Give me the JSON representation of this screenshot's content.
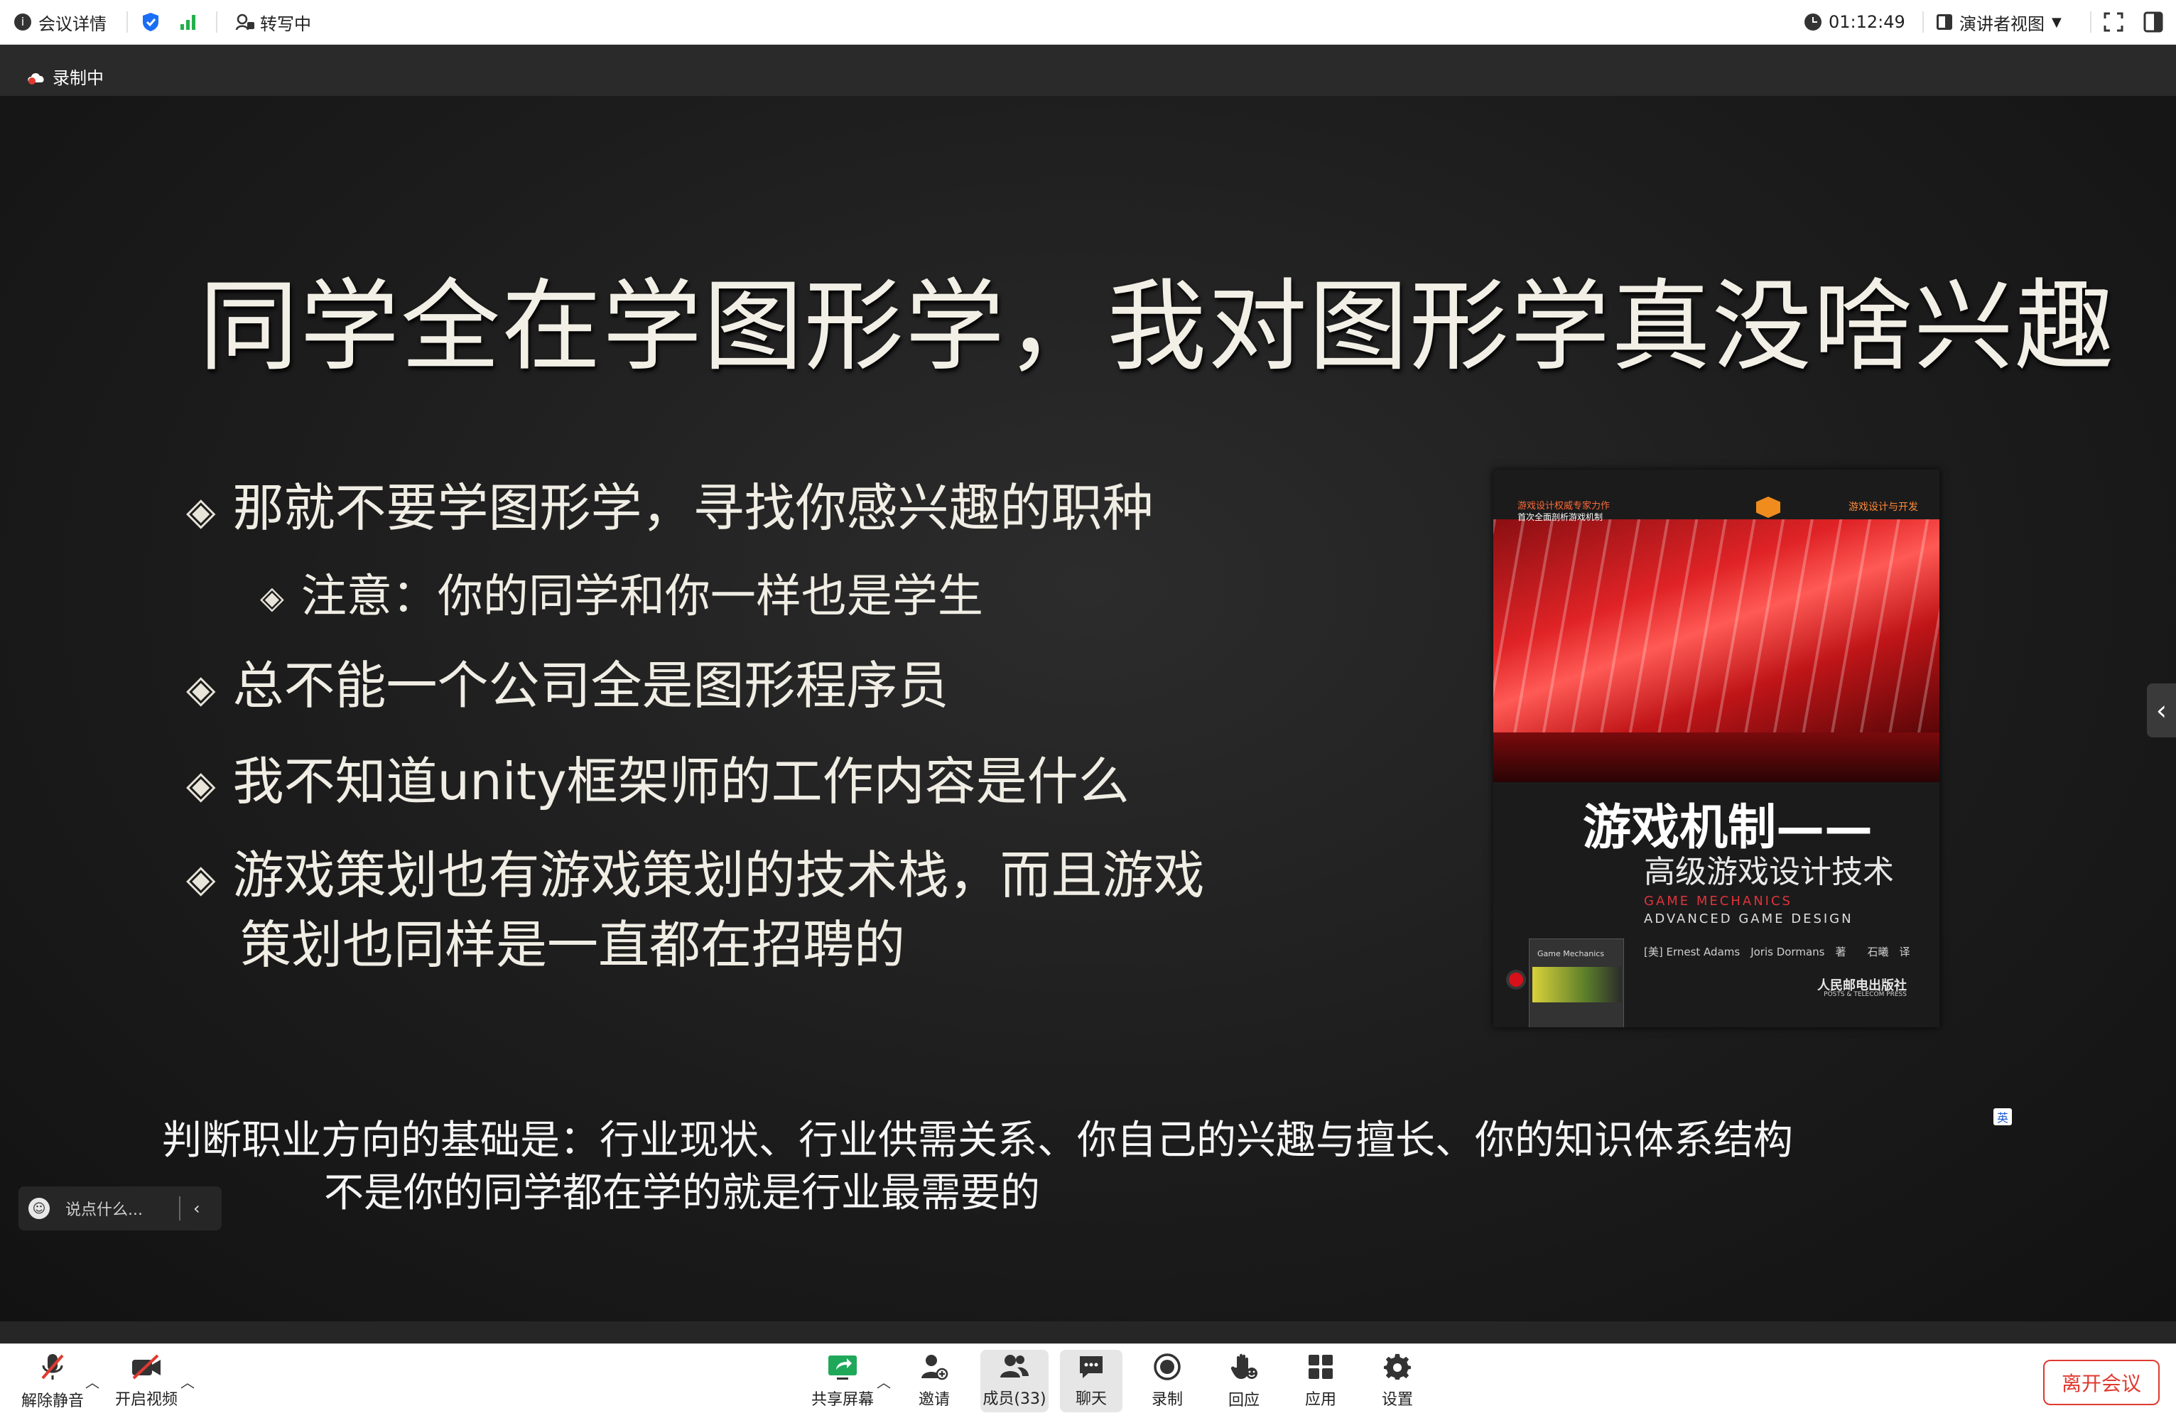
{
  "topbar": {
    "meeting_info": "会议详情",
    "transcribe": "转写中",
    "time": "01:12:49",
    "view_mode": "演讲者视图"
  },
  "recording": {
    "label": "录制中"
  },
  "slide": {
    "title": "同学全在学图形学，我对图形学真没啥兴趣",
    "bullets": [
      {
        "level": 1,
        "text": "那就不要学图形学，寻找你感兴趣的职种"
      },
      {
        "level": 2,
        "text": "注意：你的同学和你一样也是学生"
      },
      {
        "level": 1,
        "text": "总不能一个公司全是图形程序员"
      },
      {
        "level": 1,
        "text": "我不知道unity框架师的工作内容是什么"
      },
      {
        "level": 1,
        "text": "游戏策划也有游戏策划的技术栈，而且游戏"
      },
      {
        "level": 1,
        "text": "策划也同样是一直都在招聘的"
      }
    ],
    "marker": "◈",
    "book": {
      "series_line1": "游戏设计权威专家力作",
      "series_line2": "首次全面剖析游戏机制",
      "series_right": "游戏设计与开发",
      "title": "游戏机制——",
      "subtitle": "高级游戏设计技术",
      "en_line1": "GAME MECHANICS",
      "en_line2": "ADVANCED GAME DESIGN",
      "authors": "[美] Ernest Adams　Joris Dormans　著　　石曦　译",
      "publisher": "人民邮电出版社",
      "publisher_en": "POSTS & TELECOM PRESS",
      "mini_cover_label": "Game Mechanics"
    }
  },
  "captions": {
    "line1": "判断职业方向的基础是：行业现状、行业供需关系、你自己的兴趣与擅长、你的知识体系结构",
    "line2": "不是你的同学都在学的就是行业最需要的",
    "lang_badge": "英"
  },
  "chat": {
    "placeholder": "说点什么..."
  },
  "toolbar": {
    "unmute": "解除静音",
    "start_video": "开启视频",
    "share_screen": "共享屏幕",
    "invite": "邀请",
    "members": "成员(33)",
    "chat": "聊天",
    "record": "录制",
    "reactions": "回应",
    "apps": "应用",
    "settings": "设置",
    "leave": "离开会议"
  },
  "colors": {
    "accent_blue": "#1a6ef5",
    "signal_green": "#22b04b",
    "record_red": "#e03a30",
    "share_green": "#1fa85a"
  }
}
